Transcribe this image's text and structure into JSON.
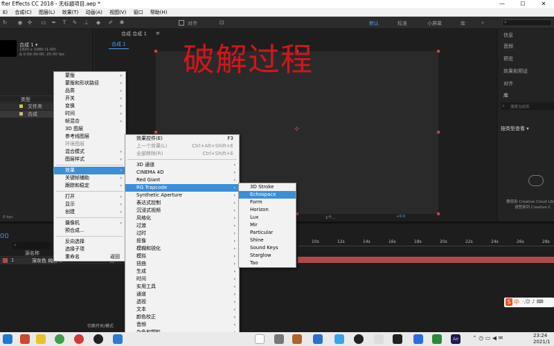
{
  "window": {
    "title": "fter Effects CC 2018 - 无标题项目.aep *",
    "minimize": "—",
    "maximize": "☐",
    "close": "✕"
  },
  "menubar": [
    "E)",
    "合成(C)",
    "图层(L)",
    "效果(T)",
    "动画(A)",
    "视图(V)",
    "窗口",
    "帮助(H)"
  ],
  "toolbar": {
    "align_label": "对齐",
    "workspaces": [
      "默认",
      "标准",
      "小屏幕",
      "库"
    ],
    "active_workspace": "默认"
  },
  "project": {
    "comp_name": "合成 1 ▾",
    "comp_info1": "1920 x 1080 (1.00)",
    "comp_info2": "Δ 0:00:30:00, 25.00 fps",
    "col_type": "类型",
    "rows": [
      "文件夹",
      "合成"
    ],
    "bpc": "8 bpc"
  },
  "comp_panel": {
    "tab": "合成 合成 1",
    "tab_menu": "≡",
    "breadcrumb": "合成 1",
    "overlay_text": "破解过程"
  },
  "right_panel": {
    "items": [
      "信息",
      "音频",
      "预览",
      "效果和预设",
      "对齐",
      "库"
    ],
    "search_placeholder": "搜索当前库",
    "view_by": "按类型查看",
    "cc_line1": "要使用 Creative Cloud Lib",
    "cc_line2": "请登录到 Creative C"
  },
  "timeline": {
    "timecode": "00",
    "layer_header": "源名称",
    "layer_num": "1",
    "layer_name": "深灰色 纯色 1",
    "parent": "无",
    "ruler": [
      "10s",
      "12s",
      "14s",
      "16s",
      "18s",
      "20s",
      "22s",
      "24s",
      "26s",
      "28s",
      "30s"
    ],
    "zoom": "1个...",
    "offset": "+0.0",
    "footer": "切换开关/模式"
  },
  "layer_menu": {
    "items": [
      {
        "label": "蒙版",
        "arrow": true
      },
      {
        "label": "蒙版和形状路径",
        "arrow": true
      },
      {
        "label": "品质",
        "arrow": true
      },
      {
        "label": "开关",
        "arrow": true
      },
      {
        "label": "变换",
        "arrow": true
      },
      {
        "label": "时间",
        "arrow": true
      },
      {
        "label": "帧混合",
        "arrow": true
      },
      {
        "label": "3D 图层"
      },
      {
        "label": "参考线图层"
      },
      {
        "label": "环境图层",
        "disabled": true
      },
      {
        "label": "混合模式",
        "arrow": true
      },
      {
        "label": "图层样式",
        "arrow": true
      },
      {
        "sep": true
      },
      {
        "label": "效果",
        "arrow": true,
        "highlight": true
      },
      {
        "label": "关键帧辅助",
        "arrow": true
      },
      {
        "label": "跟踪和稳定",
        "arrow": true
      },
      {
        "sep": true
      },
      {
        "label": "打开",
        "arrow": true
      },
      {
        "label": "显示",
        "arrow": true
      },
      {
        "label": "创建",
        "arrow": true
      },
      {
        "sep": true
      },
      {
        "label": "摄像机",
        "arrow": true
      },
      {
        "label": "预合成..."
      },
      {
        "sep": true
      },
      {
        "label": "反向选择"
      },
      {
        "label": "选择子项"
      },
      {
        "label": "重命名",
        "shortcut": "返回"
      }
    ]
  },
  "effects_menu": {
    "items": [
      {
        "label": "效果控件(E)",
        "shortcut": "F3"
      },
      {
        "label": "上一个效果(L)",
        "shortcut": "Ctrl+Alt+Shift+E",
        "disabled": true
      },
      {
        "label": "全部移除(R)",
        "shortcut": "Ctrl+Shift+E",
        "disabled": true
      },
      {
        "sep": true
      },
      {
        "label": "3D 通道",
        "arrow": true
      },
      {
        "label": "CINEMA 4D",
        "arrow": true
      },
      {
        "label": "Red Giant",
        "arrow": true
      },
      {
        "label": "RG Trapcode",
        "arrow": true,
        "highlight": true
      },
      {
        "label": "Synthetic Aperture",
        "arrow": true
      },
      {
        "label": "表达式控制",
        "arrow": true
      },
      {
        "label": "沉浸式视频",
        "arrow": true
      },
      {
        "label": "风格化",
        "arrow": true
      },
      {
        "label": "过渡",
        "arrow": true
      },
      {
        "label": "过时",
        "arrow": true
      },
      {
        "label": "抠像",
        "arrow": true
      },
      {
        "label": "模糊和锐化",
        "arrow": true
      },
      {
        "label": "模拟",
        "arrow": true
      },
      {
        "label": "扭曲",
        "arrow": true
      },
      {
        "label": "生成",
        "arrow": true
      },
      {
        "label": "时间",
        "arrow": true
      },
      {
        "label": "实用工具",
        "arrow": true
      },
      {
        "label": "通道",
        "arrow": true
      },
      {
        "label": "透视",
        "arrow": true
      },
      {
        "label": "文本",
        "arrow": true
      },
      {
        "label": "颜色校正",
        "arrow": true
      },
      {
        "label": "音频",
        "arrow": true
      },
      {
        "label": "杂色和颗粒",
        "arrow": true
      },
      {
        "label": "遮罩",
        "arrow": true
      }
    ]
  },
  "trapcode_menu": {
    "items": [
      {
        "label": "3D Stroke"
      },
      {
        "label": "Echospace",
        "highlight": true
      },
      {
        "label": "Form"
      },
      {
        "label": "Horizon"
      },
      {
        "label": "Lux"
      },
      {
        "label": "Mir"
      },
      {
        "label": "Particular"
      },
      {
        "label": "Shine"
      },
      {
        "label": "Sound Keys"
      },
      {
        "label": "Starglow"
      },
      {
        "label": "Tao"
      }
    ]
  },
  "ime": {
    "label": "中"
  },
  "clock": {
    "time": "23:24",
    "date": "2021/1"
  },
  "colors": {
    "accent": "#3b8fd8",
    "overlay_red": "#d0161b",
    "workspace_blue": "#4ba3ff",
    "layer_bar": "#b04a4a"
  }
}
